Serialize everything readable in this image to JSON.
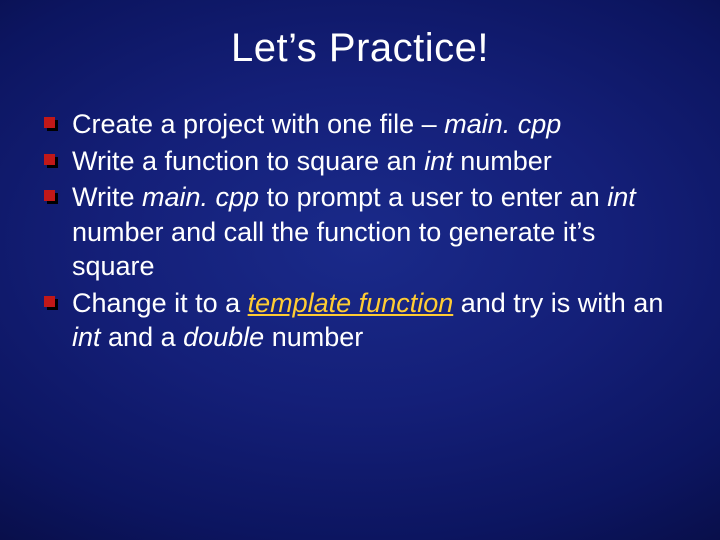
{
  "title": "Let’s Practice!",
  "items": [
    {
      "t1": "Create a project with one file – ",
      "i1": "main. cpp"
    },
    {
      "t1": "Write a function to square an ",
      "i1": "int",
      "t2": " number"
    },
    {
      "t1": "Write ",
      "i1": "main. cpp",
      "t2": " to prompt a user to enter an ",
      "i2": "int",
      "t3": " number and call the function to generate it’s square"
    },
    {
      "t1": "Change it to a ",
      "h1": "template function",
      "t2": " and try is with an ",
      "i1": "int",
      "t3": " and a ",
      "i2": "double",
      "t4": " number"
    }
  ]
}
